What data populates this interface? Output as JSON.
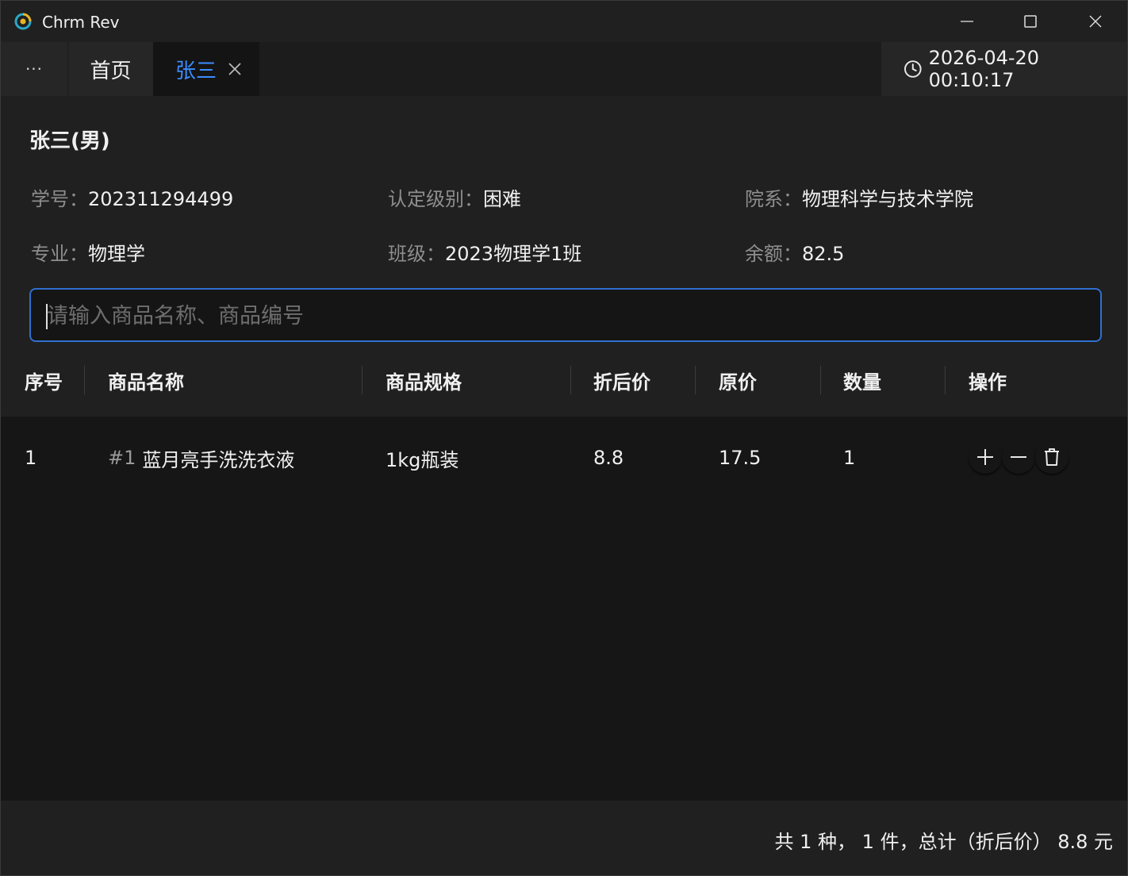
{
  "window": {
    "title": "Chrm Rev"
  },
  "tabs": {
    "more_label": "···",
    "home_label": "首页",
    "active_label": "张三",
    "active_color": "#3b8cff"
  },
  "clock": {
    "datetime": "2026-04-20 00:10:17"
  },
  "student": {
    "name": "张三(男)",
    "fields": [
      {
        "label": "学号",
        "value": "202311294499"
      },
      {
        "label": "认定级别",
        "value": "困难"
      },
      {
        "label": "院系",
        "value": "物理科学与技术学院"
      },
      {
        "label": "专业",
        "value": "物理学"
      },
      {
        "label": "班级",
        "value": "2023物理学1班"
      },
      {
        "label": "余额",
        "value": "82.5"
      }
    ],
    "separator": "："
  },
  "search": {
    "placeholder": "请输入商品名称、商品编号",
    "value": "",
    "border_color": "#2f6fcf"
  },
  "table": {
    "headers": [
      "序号",
      "商品名称",
      "商品规格",
      "折后价",
      "原价",
      "数量",
      "操作"
    ],
    "rows": [
      {
        "index": "1",
        "code": "#1",
        "name": "蓝月亮手洗洗衣液",
        "spec": "1kg瓶装",
        "discount_price": "8.8",
        "original_price": "17.5",
        "quantity": "1"
      }
    ],
    "actions": [
      "plus-icon",
      "minus-icon",
      "trash-icon"
    ]
  },
  "footer": {
    "summary": "共 1 种， 1 件，总计（折后价） 8.8 元"
  }
}
